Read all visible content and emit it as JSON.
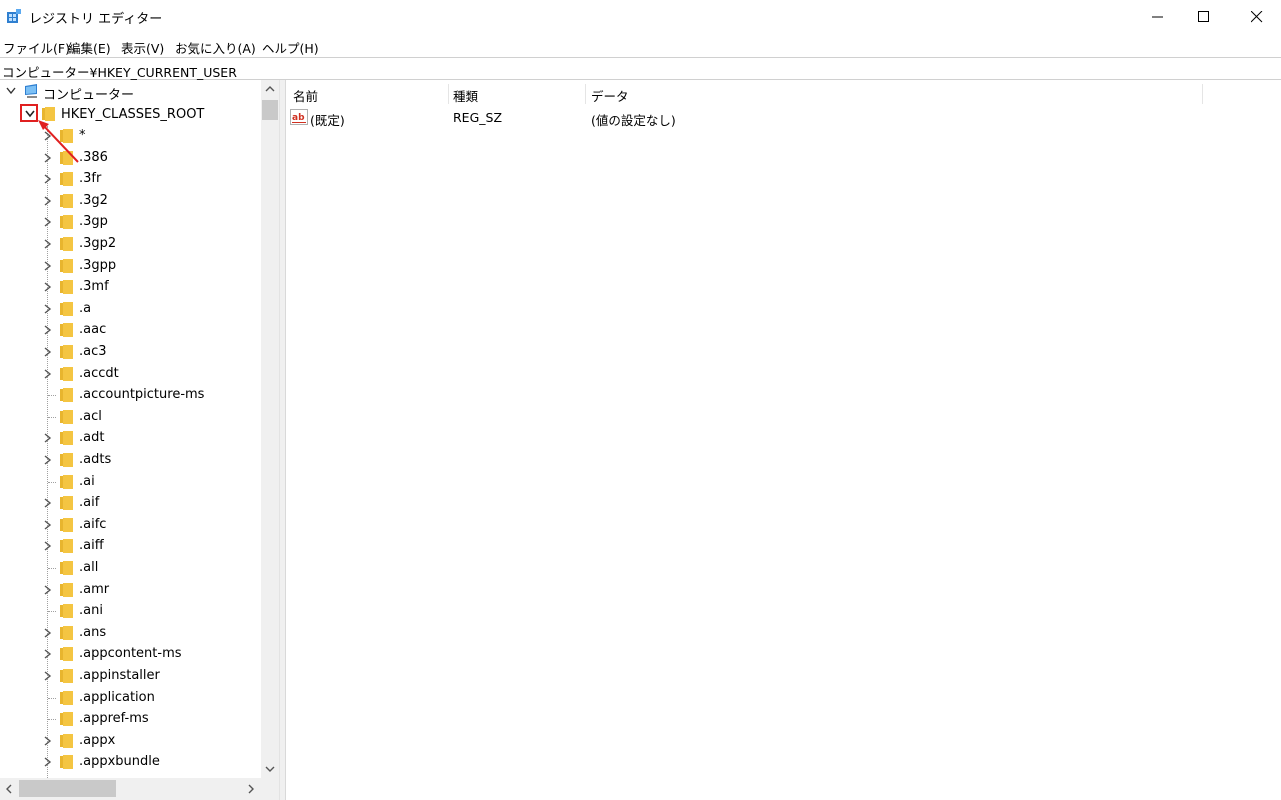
{
  "window": {
    "title": "レジストリ エディター",
    "controls": {
      "minimize": "minimize",
      "maximize": "maximize",
      "close": "close"
    }
  },
  "menu": [
    "ファイル(F)",
    "編集(E)",
    "表示(V)",
    "お気に入り(A)",
    "ヘルプ(H)"
  ],
  "address": "コンピューター¥HKEY_CURRENT_USER",
  "tree": {
    "root": "コンピューター",
    "hive": "HKEY_CLASSES_ROOT",
    "items": [
      {
        "label": "*",
        "expandable": true
      },
      {
        "label": ".386",
        "expandable": true
      },
      {
        "label": ".3fr",
        "expandable": true
      },
      {
        "label": ".3g2",
        "expandable": true
      },
      {
        "label": ".3gp",
        "expandable": true
      },
      {
        "label": ".3gp2",
        "expandable": true
      },
      {
        "label": ".3gpp",
        "expandable": true
      },
      {
        "label": ".3mf",
        "expandable": true
      },
      {
        "label": ".a",
        "expandable": true
      },
      {
        "label": ".aac",
        "expandable": true
      },
      {
        "label": ".ac3",
        "expandable": true
      },
      {
        "label": ".accdt",
        "expandable": true
      },
      {
        "label": ".accountpicture-ms",
        "expandable": false
      },
      {
        "label": ".acl",
        "expandable": false
      },
      {
        "label": ".adt",
        "expandable": true
      },
      {
        "label": ".adts",
        "expandable": true
      },
      {
        "label": ".ai",
        "expandable": false
      },
      {
        "label": ".aif",
        "expandable": true
      },
      {
        "label": ".aifc",
        "expandable": true
      },
      {
        "label": ".aiff",
        "expandable": true
      },
      {
        "label": ".all",
        "expandable": false
      },
      {
        "label": ".amr",
        "expandable": true
      },
      {
        "label": ".ani",
        "expandable": false
      },
      {
        "label": ".ans",
        "expandable": true
      },
      {
        "label": ".appcontent-ms",
        "expandable": true
      },
      {
        "label": ".appinstaller",
        "expandable": true
      },
      {
        "label": ".application",
        "expandable": false
      },
      {
        "label": ".appref-ms",
        "expandable": false
      },
      {
        "label": ".appx",
        "expandable": true
      },
      {
        "label": ".appxbundle",
        "expandable": true
      }
    ]
  },
  "list": {
    "columns": [
      "名前",
      "種類",
      "データ"
    ],
    "rows": [
      {
        "name": "(既定)",
        "type": "REG_SZ",
        "data": "(値の設定なし)"
      }
    ]
  },
  "colors": {
    "folder": "#f4c542",
    "highlight_box": "#e02020",
    "arrow": "#e02020",
    "computer_icon": "#2f7fd0"
  },
  "icons": [
    "regedit-app-icon",
    "computer-icon",
    "folder-icon",
    "string-value-icon",
    "chevron-right-icon",
    "chevron-down-icon"
  ]
}
